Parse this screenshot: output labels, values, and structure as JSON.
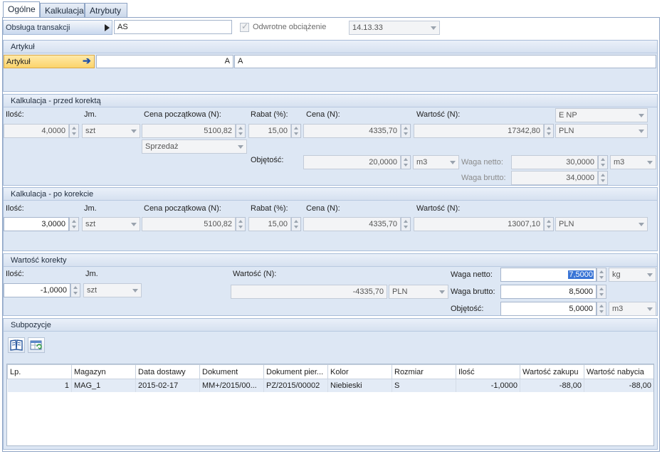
{
  "tabs": [
    "Ogólne",
    "Kalkulacja",
    "Atrybuty"
  ],
  "header": {
    "transaction_label": "Obsługa transakcji",
    "transaction_value": "AS",
    "reverse_charge_label": "Odwrotne obciążenie",
    "reverse_charge_checked": true,
    "code_value": "14.13.33"
  },
  "artykul": {
    "title": "Artykuł",
    "button_label": "Artykuł",
    "code": "A",
    "name": "A"
  },
  "before": {
    "title": "Kalkulacja - przed korektą",
    "labels": {
      "qty": "Ilość:",
      "unit": "Jm.",
      "start_price": "Cena początkowa (N):",
      "discount": "Rabat (%):",
      "price": "Cena (N):",
      "value": "Wartość (N):",
      "volume": "Objętość:",
      "net_weight": "Waga netto:",
      "gross_weight": "Waga brutto:"
    },
    "vat": "E NP",
    "qty": "4,0000",
    "unit": "szt",
    "start_price": "5100,82",
    "discount": "15,00",
    "price": "4335,70",
    "value": "17342,80",
    "currency": "PLN",
    "price_type": "Sprzedaż",
    "volume": "20,0000",
    "volume_unit": "m3",
    "net_weight": "30,0000",
    "weight_unit": "m3",
    "gross_weight": "34,0000"
  },
  "after": {
    "title": "Kalkulacja - po korekcie",
    "labels": {
      "qty": "Ilość:",
      "unit": "Jm.",
      "start_price": "Cena początkowa (N):",
      "discount": "Rabat (%):",
      "price": "Cena (N):",
      "value": "Wartość (N):"
    },
    "qty": "3,0000",
    "unit": "szt",
    "start_price": "5100,82",
    "discount": "15,00",
    "price": "4335,70",
    "value": "13007,10",
    "currency": "PLN"
  },
  "correction": {
    "title": "Wartość korekty",
    "labels": {
      "qty": "Ilość:",
      "unit": "Jm.",
      "value": "Wartość (N):",
      "net_weight": "Waga netto:",
      "gross_weight": "Waga brutto:",
      "volume": "Objętość:"
    },
    "qty": "-1,0000",
    "unit": "szt",
    "value": "-4335,70",
    "currency": "PLN",
    "net_weight": "7,5000",
    "net_weight_unit": "kg",
    "gross_weight": "8,5000",
    "volume": "5,0000",
    "volume_unit": "m3"
  },
  "subpositions": {
    "title": "Subpozycje",
    "columns": [
      "Lp.",
      "Magazyn",
      "Data dostawy",
      "Dokument",
      "Dokument pier...",
      "Kolor",
      "Rozmiar",
      "Ilość",
      "Wartość zakupu",
      "Wartość nabycia"
    ],
    "rows": [
      [
        "1",
        "MAG_1",
        "2015-02-17",
        "MM+/2015/00...",
        "PZ/2015/00002",
        "Niebieski",
        "S",
        "-1,0000",
        "-88,00",
        "-88,00"
      ]
    ]
  }
}
